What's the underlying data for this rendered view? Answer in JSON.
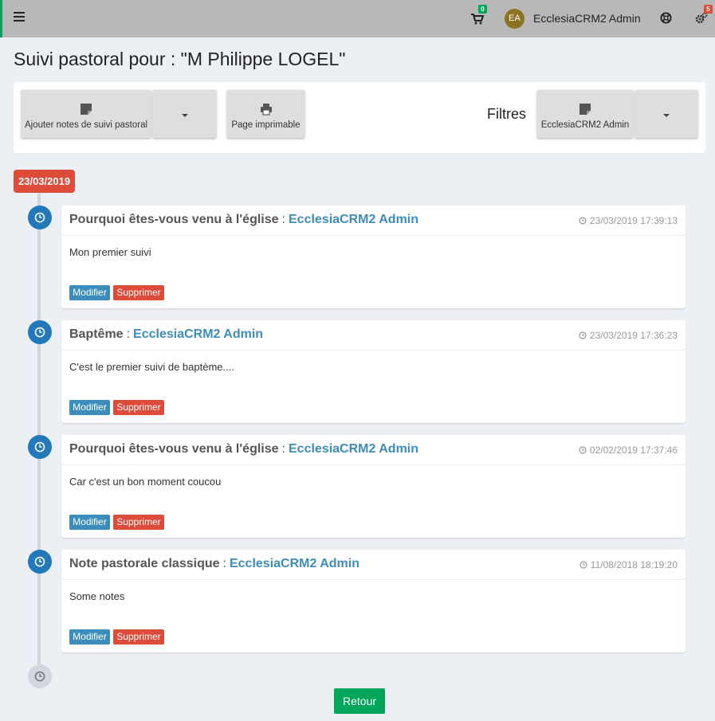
{
  "navbar": {
    "cart_count": "0",
    "avatar_initials": "EA",
    "user_name": "EcclesiaCRM2 Admin",
    "notifications_count": "5",
    "icons": [
      "menu-icon",
      "cart-icon",
      "lifebuoy-icon",
      "gears-icon"
    ]
  },
  "page": {
    "title": "Suivi pastoral pour : \"M Philippe LOGEL\""
  },
  "toolbar": {
    "add_note_label": "Ajouter notes de suivi pastoral",
    "printable_label": "Page imprimable",
    "filters_label": "Filtres",
    "filter_user_label": "EcclesiaCRM2 Admin"
  },
  "timeline": {
    "date_label": "23/03/2019",
    "entries": [
      {
        "topic": "Pourquoi êtes-vous venu à l'église",
        "separator": ":",
        "author": "EcclesiaCRM2 Admin",
        "timestamp": "23/03/2019 17:39:13",
        "text": "Mon premier suivi",
        "edit_label": "Modifier",
        "delete_label": "Supprimer"
      },
      {
        "topic": "Baptême",
        "separator": ":",
        "author": "EcclesiaCRM2 Admin",
        "timestamp": "23/03/2019 17:36:23",
        "text": "C'est le premier suivi de baptème....",
        "edit_label": "Modifier",
        "delete_label": "Supprimer"
      },
      {
        "topic": "Pourquoi êtes-vous venu à l'église",
        "separator": ":",
        "author": "EcclesiaCRM2 Admin",
        "timestamp": "02/02/2019 17:37:46",
        "text": "Car c'est un bon moment coucou",
        "edit_label": "Modifier",
        "delete_label": "Supprimer"
      },
      {
        "topic": "Note pastorale classique",
        "separator": ":",
        "author": "EcclesiaCRM2 Admin",
        "timestamp": "11/08/2018 18:19:20",
        "text": "Some notes",
        "edit_label": "Modifier",
        "delete_label": "Supprimer"
      }
    ]
  },
  "footer": {
    "back_label": "Retour"
  },
  "colors": {
    "primary": "#3c8dbc",
    "danger": "#dd4b39",
    "success": "#00a65a",
    "timeline_icon": "#2378ba"
  }
}
